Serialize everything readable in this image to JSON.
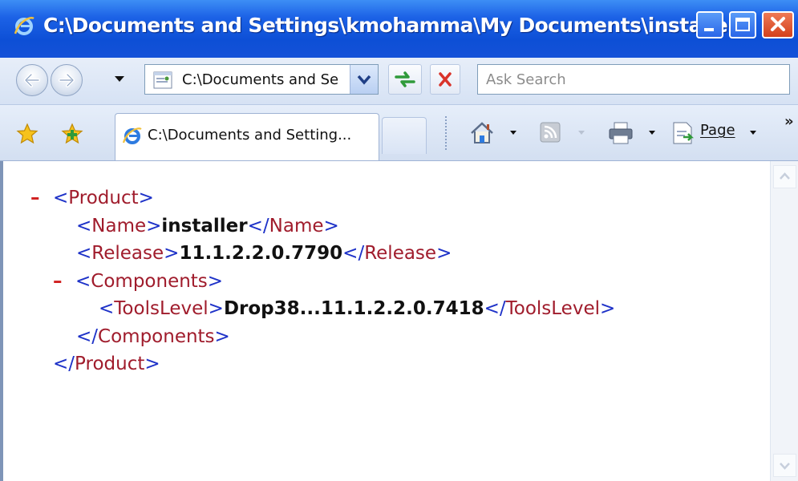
{
  "window": {
    "title": "C:\\Documents and Settings\\kmohamma\\My Documents\\installe..."
  },
  "navbar": {
    "address": "C:\\Documents and Se",
    "search_placeholder": "Ask Search"
  },
  "tabbar": {
    "tab_label": "C:\\Documents and Setting...",
    "page_label": "Page",
    "overflow": "»"
  },
  "xml": {
    "minus": "–",
    "product_open": "Product",
    "name_tag": "Name",
    "name_value": "installer",
    "release_tag": "Release",
    "release_value": "11.1.2.2.0.7790",
    "components_tag": "Components",
    "toolslevel_tag": "ToolsLevel",
    "toolslevel_value": "Drop38...11.1.2.2.0.7418",
    "components_close": "Components",
    "product_close": "Product"
  },
  "colors": {
    "titlebar": "#1c62e6",
    "xml_bracket": "#1e32c8",
    "xml_tagname": "#a01c2c",
    "xml_minus": "#d02020"
  },
  "icons": [
    "ie-logo-icon",
    "minimize-icon",
    "maximize-icon",
    "close-icon",
    "back-arrow-icon",
    "forward-arrow-icon",
    "recent-pages-dropdown-icon",
    "address-page-icon",
    "address-dropdown-icon",
    "refresh-icon",
    "stop-icon",
    "favorites-star-icon",
    "add-favorites-icon",
    "tab-ie-icon",
    "home-icon",
    "rss-feed-icon",
    "print-icon",
    "page-icon",
    "scroll-up-icon",
    "scroll-down-icon"
  ]
}
